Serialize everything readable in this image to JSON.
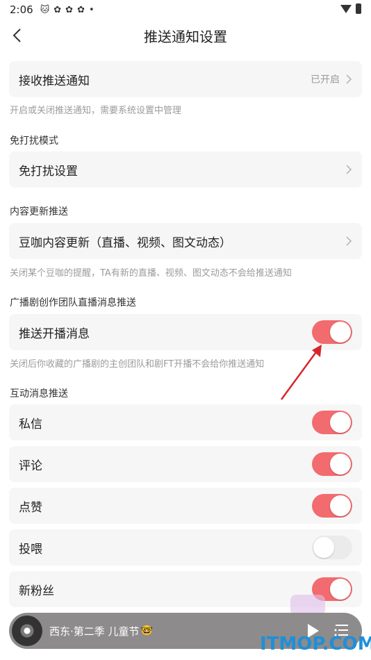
{
  "status_bar": {
    "time": "2:06",
    "icons": [
      "cat-icon",
      "flower-icon",
      "flower-icon",
      "flower-icon",
      "dot-icon",
      "wifi-icon",
      "battery-icon"
    ]
  },
  "header": {
    "title": "推送通知设置",
    "back_icon": "back-arrow-icon"
  },
  "receive_push": {
    "label": "接收推送通知",
    "value": "已开启",
    "hint": "开启或关闭推送通知，需要系统设置中管理"
  },
  "dnd": {
    "section_title": "免打扰模式",
    "label": "免打扰设置"
  },
  "content_update": {
    "section_title": "内容更新推送",
    "label": "豆咖内容更新（直播、视频、图文动态）",
    "hint": "关闭某个豆咖的提醒，TA有新的直播、视频、图文动态不会给推送通知"
  },
  "radio_drama": {
    "section_title": "广播剧创作团队直播消息推送",
    "label": "推送开播消息",
    "on": true,
    "hint": "关闭后你收藏的广播剧的主创团队和剧FT开播不会给你推送通知"
  },
  "interaction": {
    "section_title": "互动消息推送",
    "items": [
      {
        "label": "私信",
        "on": true
      },
      {
        "label": "评论",
        "on": true
      },
      {
        "label": "点赞",
        "on": true
      },
      {
        "label": "投喂",
        "on": false
      },
      {
        "label": "新粉丝",
        "on": true
      }
    ]
  },
  "mini_player": {
    "title": "西东·第二季 儿童节",
    "emoji": "🤓"
  },
  "watermark": "ITMOP.COM",
  "colors": {
    "toggle_on": "#f26b6f",
    "toggle_off": "#ebebeb",
    "card_bg": "#f6f6f6",
    "annotation_arrow": "#d7262b",
    "watermark": "#1e8fd9"
  }
}
